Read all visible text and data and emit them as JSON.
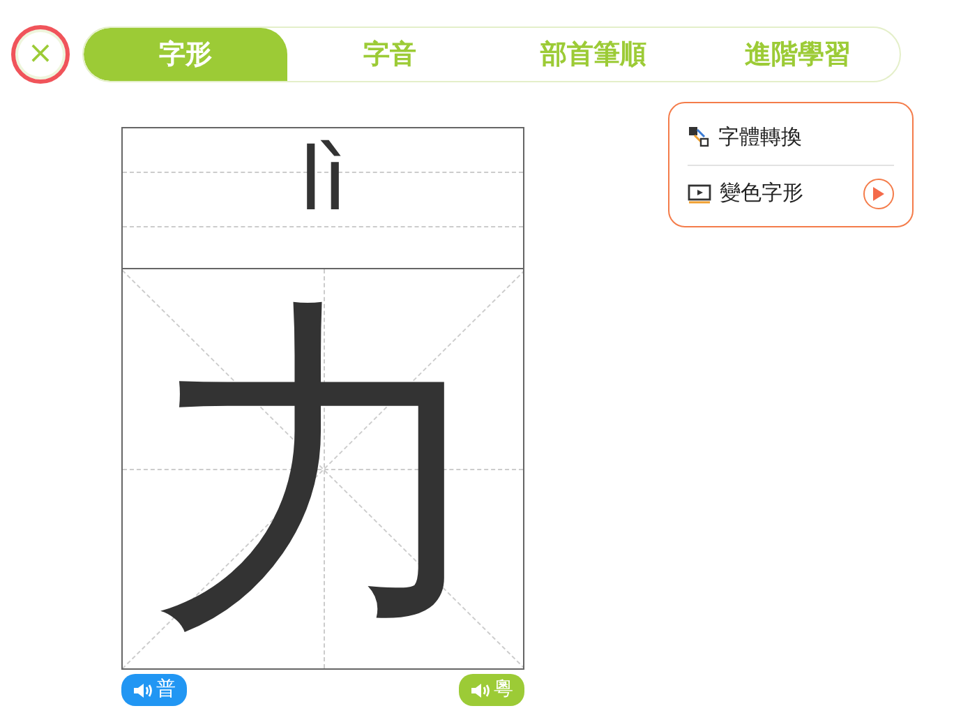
{
  "close_button": {
    "label": "×"
  },
  "tabs": [
    {
      "label": "字形",
      "selected": true
    },
    {
      "label": "字音",
      "selected": false
    },
    {
      "label": "部首筆順",
      "selected": false
    },
    {
      "label": "進階學習",
      "selected": false
    }
  ],
  "practice_grid": {
    "pinyin": "lì",
    "character": "力"
  },
  "audio_buttons": [
    {
      "label": "普",
      "color": "#2196f3"
    },
    {
      "label": "粵",
      "color": "#9ccb36"
    }
  ],
  "tools_menu": [
    {
      "label": "字體轉換",
      "kind": "convert"
    },
    {
      "label": "變色字形",
      "kind": "animate"
    }
  ]
}
